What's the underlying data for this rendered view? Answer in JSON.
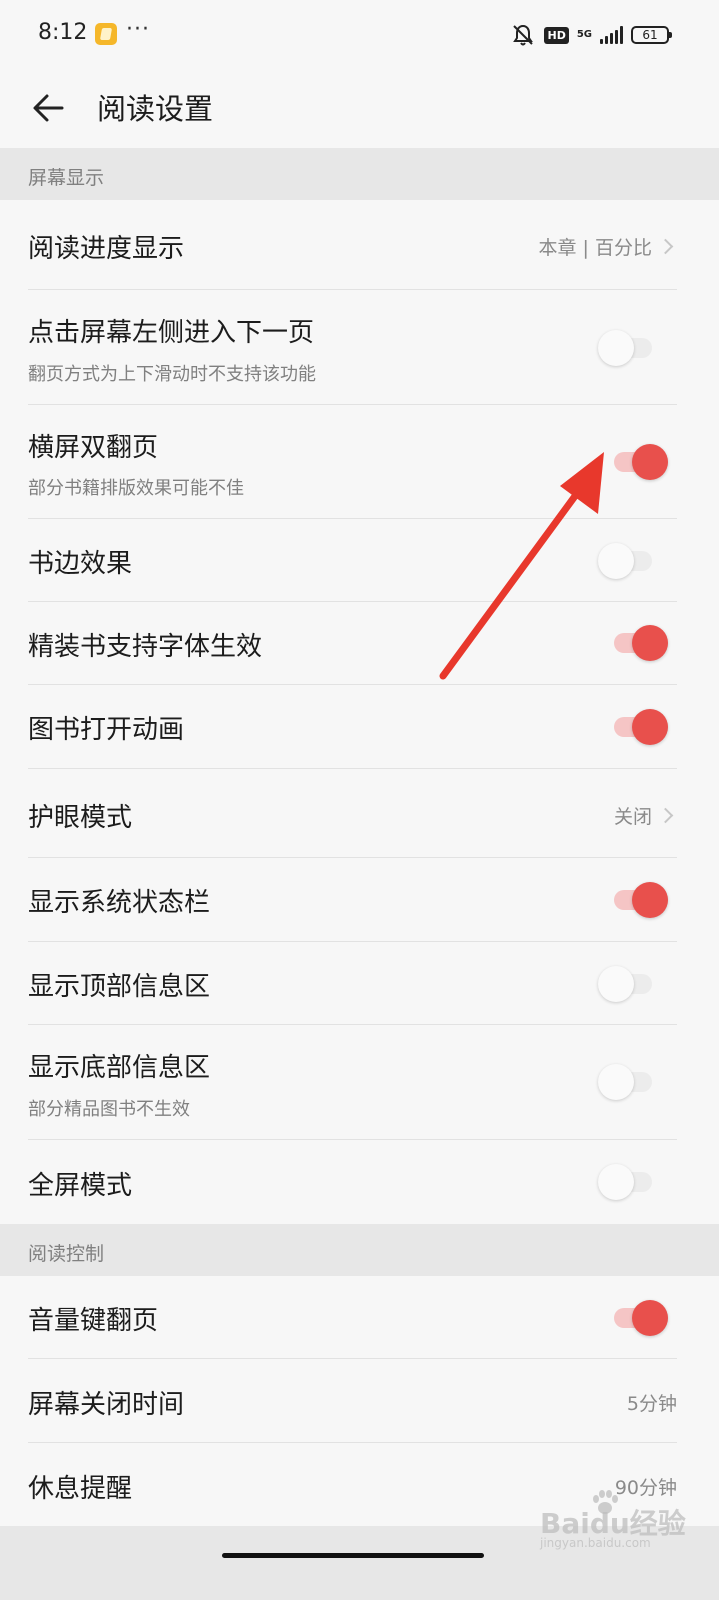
{
  "status_bar": {
    "time": "8:12",
    "more": "···",
    "hd": "HD",
    "network": "5G",
    "battery": "61"
  },
  "header": {
    "title": "阅读设置"
  },
  "sections": [
    {
      "title": "屏幕显示"
    },
    {
      "title": "阅读控制"
    }
  ],
  "rows": [
    {
      "label": "阅读进度显示",
      "value": "本章 | 百分比"
    },
    {
      "label": "点击屏幕左侧进入下一页",
      "sub": "翻页方式为上下滑动时不支持该功能",
      "toggle": false
    },
    {
      "label": "横屏双翻页",
      "sub": "部分书籍排版效果可能不佳",
      "toggle": true
    },
    {
      "label": "书边效果",
      "toggle": false
    },
    {
      "label": "精装书支持字体生效",
      "toggle": true
    },
    {
      "label": "图书打开动画",
      "toggle": true
    },
    {
      "label": "护眼模式",
      "value": "关闭"
    },
    {
      "label": "显示系统状态栏",
      "toggle": true
    },
    {
      "label": "显示顶部信息区",
      "toggle": false
    },
    {
      "label": "显示底部信息区",
      "sub": "部分精品图书不生效",
      "toggle": false
    },
    {
      "label": "全屏模式",
      "toggle": false
    },
    {
      "label": "音量键翻页",
      "toggle": true
    },
    {
      "label": "屏幕关闭时间",
      "value": "5分钟"
    },
    {
      "label": "休息提醒",
      "value": "90分钟"
    }
  ],
  "watermark": {
    "text": "Baidu经验",
    "sub": "jingyan.baidu.com"
  },
  "colors": {
    "accent": "#e8504c",
    "arrow": "#e8382c",
    "section_bg": "#e7e7e7",
    "page_bg": "#f7f7f7"
  }
}
